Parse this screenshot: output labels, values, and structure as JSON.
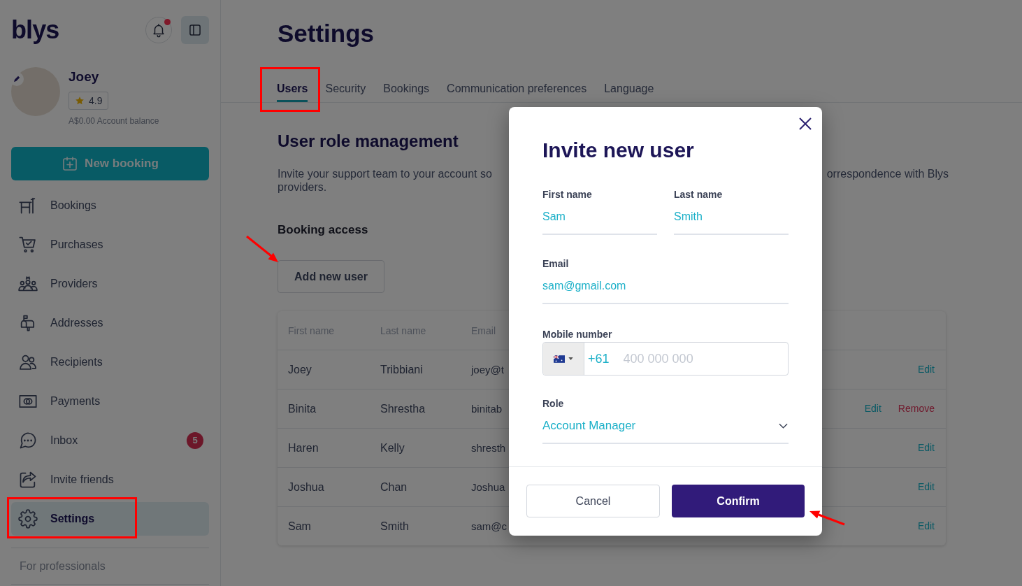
{
  "sidebar": {
    "logo": "blys",
    "notifications": {
      "unread": true
    },
    "profile": {
      "name": "Joey",
      "rating": "4.9",
      "balance": "A$0.00 Account balance"
    },
    "new_booking": "New booking",
    "nav": [
      {
        "kind": "bookings",
        "label": "Bookings",
        "selected": false,
        "highlighted": false
      },
      {
        "kind": "purchases",
        "label": "Purchases",
        "selected": false,
        "highlighted": false
      },
      {
        "kind": "providers",
        "label": "Providers",
        "selected": false,
        "highlighted": false
      },
      {
        "kind": "addresses",
        "label": "Addresses",
        "selected": false,
        "highlighted": false
      },
      {
        "kind": "recipients",
        "label": "Recipients",
        "selected": false,
        "highlighted": false
      },
      {
        "kind": "payments",
        "label": "Payments",
        "selected": false,
        "highlighted": false
      },
      {
        "kind": "inbox",
        "label": "Inbox",
        "badge": "5",
        "selected": false,
        "highlighted": false
      },
      {
        "kind": "invite",
        "label": "Invite friends",
        "selected": false,
        "highlighted": false
      },
      {
        "kind": "settings",
        "label": "Settings",
        "selected": true,
        "highlighted": true
      }
    ],
    "footer_link": "For professionals"
  },
  "page": {
    "title": "Settings",
    "tabs": [
      {
        "label": "Users",
        "selected": true,
        "highlighted": true
      },
      {
        "label": "Security",
        "selected": false,
        "highlighted": false
      },
      {
        "label": "Bookings",
        "selected": false,
        "highlighted": false
      },
      {
        "label": "Communication preferences",
        "selected": false,
        "highlighted": false
      },
      {
        "label": "Language",
        "selected": false,
        "highlighted": false
      }
    ],
    "section_title": "User role management",
    "description_lines": [
      [
        "Invite your support team to your account so",
        "orrespondence with Blys"
      ],
      [
        "providers."
      ]
    ],
    "subsection_title": "Booking access",
    "add_button": {
      "label": "Add new user",
      "pointed": true
    }
  },
  "table": {
    "columns": [
      "First name",
      "Last name",
      "Email"
    ],
    "rows": [
      {
        "first_name": "Joey",
        "last_name": "Tribbiani",
        "email": "joey@t",
        "actions": [
          {
            "kind": "edit",
            "label": "Edit"
          }
        ]
      },
      {
        "first_name": "Binita",
        "last_name": "Shrestha",
        "email": "binitab",
        "actions": [
          {
            "kind": "edit",
            "label": "Edit"
          },
          {
            "kind": "remove",
            "label": "Remove"
          }
        ]
      },
      {
        "first_name": "Haren",
        "last_name": "Kelly",
        "email": "shresth",
        "actions": [
          {
            "kind": "edit",
            "label": "Edit"
          }
        ]
      },
      {
        "first_name": "Joshua",
        "last_name": "Chan",
        "email": "Joshua",
        "actions": [
          {
            "kind": "edit",
            "label": "Edit"
          }
        ]
      },
      {
        "first_name": "Sam",
        "last_name": "Smith",
        "email": "sam@c",
        "actions": [
          {
            "kind": "edit",
            "label": "Edit"
          }
        ]
      }
    ]
  },
  "modal": {
    "title": "Invite new user",
    "field_rows": [
      [
        {
          "kind": "text",
          "label": "First name",
          "value": "Sam"
        },
        {
          "kind": "text",
          "label": "Last name",
          "value": "Smith"
        }
      ],
      [
        {
          "kind": "text",
          "label": "Email",
          "value": "sam@gmail.com"
        }
      ],
      [
        {
          "kind": "phone",
          "label": "Mobile number",
          "country_code": "+61",
          "placeholder": "400 000 000"
        }
      ],
      [
        {
          "kind": "select",
          "label": "Role",
          "value": "Account Manager"
        }
      ]
    ],
    "buttons": [
      {
        "kind": "secondary",
        "label": "Cancel",
        "pointed": false
      },
      {
        "kind": "primary",
        "label": "Confirm",
        "pointed": true
      }
    ]
  }
}
